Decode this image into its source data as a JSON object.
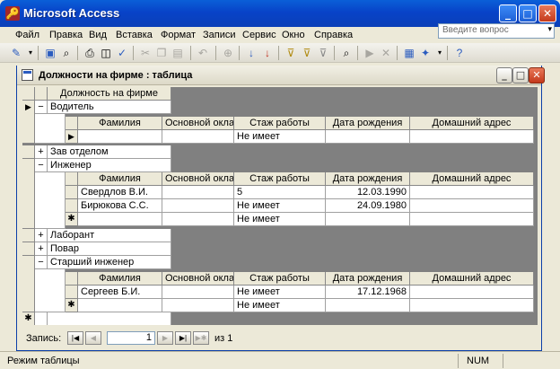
{
  "app": {
    "title": "Microsoft Access",
    "icon": "access-key-icon",
    "minimize": "_",
    "maximize": "□",
    "close": "✕"
  },
  "menu": [
    "Файл",
    "Правка",
    "Вид",
    "Вставка",
    "Формат",
    "Записи",
    "Сервис",
    "Окно",
    "Справка"
  ],
  "help_search": {
    "placeholder": "Введите вопрос",
    "dropdown": "▾"
  },
  "toolbar": {
    "icons": [
      "view-design-icon",
      "view-dropdown-icon",
      "save-icon",
      "search-file-icon",
      "print-icon",
      "print-preview-icon",
      "spelling-icon",
      "cut-icon",
      "copy-icon",
      "paste-icon",
      "undo-icon",
      "hyperlink-icon",
      "sort-ascending-icon",
      "sort-descending-icon",
      "filter-by-selection-icon",
      "filter-by-form-icon",
      "apply-filter-icon",
      "find-icon",
      "new-record-icon",
      "delete-record-icon",
      "database-window-icon",
      "new-object-icon",
      "help-icon"
    ]
  },
  "doc_window": {
    "title": "Должности на фирме : таблица",
    "minimize": "_",
    "maximize": "□",
    "close": "✕"
  },
  "datasheet": {
    "main_header": "Должность на фирме",
    "subtable_headers": [
      "Фамилия",
      "Основной окла",
      "Стаж работы",
      "Дата рождения",
      "Домашний адрес"
    ],
    "rows": [
      {
        "expander": "−",
        "selector": "▶",
        "position": "Водитель",
        "subrows": [
          {
            "selector": "▶",
            "cells": [
              "",
              "",
              "Не имеет",
              "",
              ""
            ]
          }
        ]
      },
      {
        "expander": "+",
        "selector": "",
        "position": "Зав отделом"
      },
      {
        "expander": "−",
        "selector": "",
        "position": "Инженер",
        "subrows": [
          {
            "selector": "",
            "cells": [
              "Свердлов В.И.",
              "",
              "5",
              "12.03.1990",
              ""
            ]
          },
          {
            "selector": "",
            "cells": [
              "Бирюкова С.С.",
              "",
              "Не имеет",
              "24.09.1980",
              ""
            ]
          },
          {
            "selector": "✱",
            "cells": [
              "",
              "",
              "Не имеет",
              "",
              ""
            ]
          }
        ]
      },
      {
        "expander": "+",
        "selector": "",
        "position": "Лаборант"
      },
      {
        "expander": "+",
        "selector": "",
        "position": "Повар"
      },
      {
        "expander": "−",
        "selector": "",
        "position": "Старший инженер",
        "subrows": [
          {
            "selector": "",
            "cells": [
              "Сергеев Б.И.",
              "",
              "Не имеет",
              "17.12.1968",
              ""
            ]
          },
          {
            "selector": "✱",
            "cells": [
              "",
              "",
              "Не имеет",
              "",
              ""
            ]
          }
        ]
      }
    ],
    "new_row_selector": "✱"
  },
  "record_nav": {
    "label": "Запись:",
    "current": "1",
    "of_label": "из  1",
    "first": "|◀",
    "prev": "◀",
    "next": "▶",
    "last": "▶|",
    "new": "▶✱"
  },
  "status": {
    "mode": "Режим таблицы",
    "num": "NUM"
  }
}
